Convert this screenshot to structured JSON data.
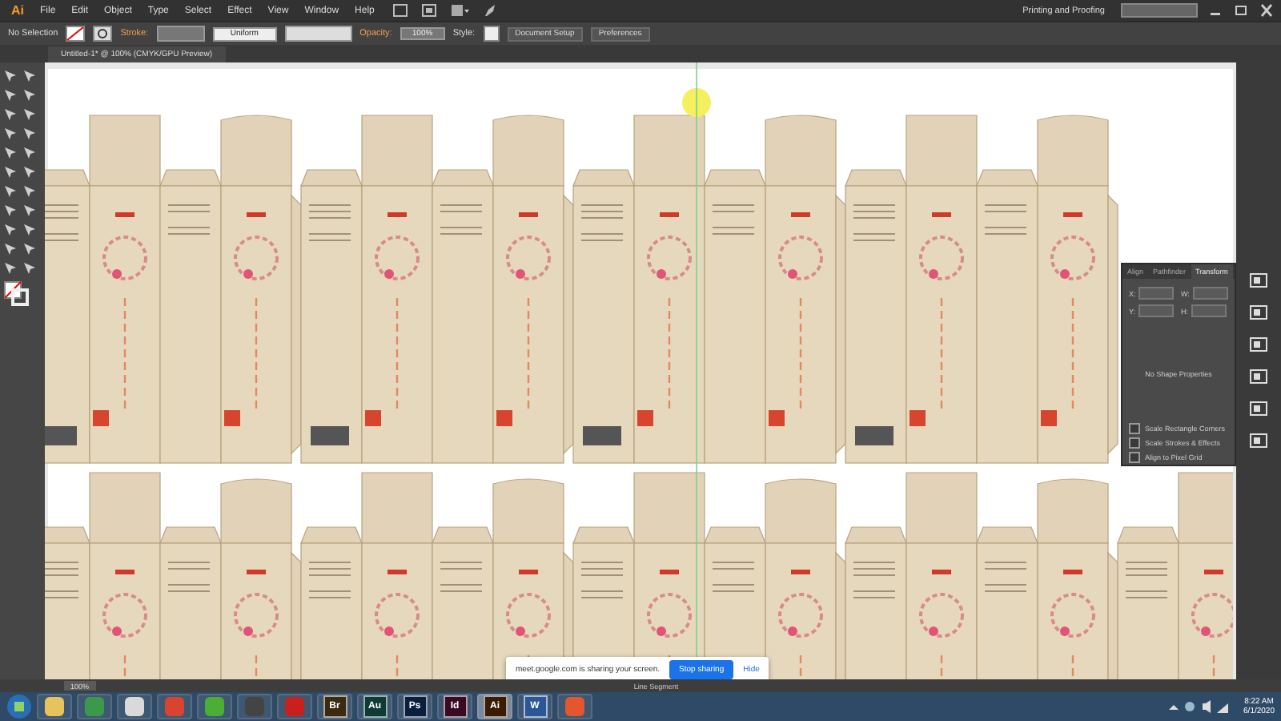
{
  "app": {
    "logo": "Ai",
    "menu": [
      "File",
      "Edit",
      "Object",
      "Type",
      "Select",
      "Effect",
      "View",
      "Window",
      "Help"
    ],
    "workspace": "Printing and Proofing"
  },
  "control_bar": {
    "selection": "No Selection",
    "stroke_label": "Stroke:",
    "stroke_profile": "Uniform",
    "opacity_label": "Opacity:",
    "opacity": "100%",
    "style_label": "Style:",
    "buttons": [
      "Document Setup",
      "Preferences"
    ]
  },
  "document_tab": {
    "title": "Untitled-1* @ 100% (CMYK/GPU Preview)"
  },
  "panel": {
    "tabs": [
      {
        "label": "Align",
        "selected": false
      },
      {
        "label": "Pathfinder",
        "selected": false
      },
      {
        "label": "Transform",
        "selected": true
      }
    ],
    "fields": [
      "X:",
      "W:",
      "Y:",
      "H:"
    ],
    "message": "No Shape Properties",
    "options": [
      {
        "label": "Scale Rectangle Corners",
        "checked": false
      },
      {
        "label": "Scale Strokes & Effects",
        "checked": false
      },
      {
        "label": "Align to Pixel Grid",
        "checked": false
      }
    ]
  },
  "status_bar": {
    "zoom": "100%",
    "tool": "Line Segment"
  },
  "share_bar": {
    "message": "meet.google.com is sharing your screen.",
    "stop_button": "Stop sharing",
    "hide_link": "Hide"
  },
  "taskbar": {
    "apps": [
      {
        "kind": "logo",
        "color": "#e8c25a",
        "selected": false
      },
      {
        "kind": "logo",
        "color": "#3b9a4a",
        "selected": false
      },
      {
        "kind": "logo",
        "color": "#d9d9d9",
        "selected": false
      },
      {
        "kind": "logo",
        "color": "#d8442f",
        "selected": false
      },
      {
        "kind": "logo",
        "color": "#4caf35",
        "selected": false
      },
      {
        "kind": "logo",
        "color": "#444444",
        "selected": false
      },
      {
        "kind": "logo",
        "color": "#c8201c",
        "selected": false
      },
      {
        "kind": "letter",
        "label": "Br",
        "color": "#3a2a10",
        "selected": false
      },
      {
        "kind": "letter",
        "label": "Au",
        "color": "#0e3b34",
        "selected": false
      },
      {
        "kind": "letter",
        "label": "Ps",
        "color": "#0a1f3d",
        "selected": false
      },
      {
        "kind": "letter",
        "label": "Id",
        "color": "#3a0a22",
        "selected": false
      },
      {
        "kind": "letter",
        "label": "Ai",
        "color": "#3a1c05",
        "selected": true
      },
      {
        "kind": "letter",
        "label": "W",
        "color": "#2b5797",
        "selected": false
      },
      {
        "kind": "logo",
        "color": "#e4572e",
        "selected": false
      }
    ],
    "time": "8:22 AM",
    "date": "6/1/2020"
  }
}
